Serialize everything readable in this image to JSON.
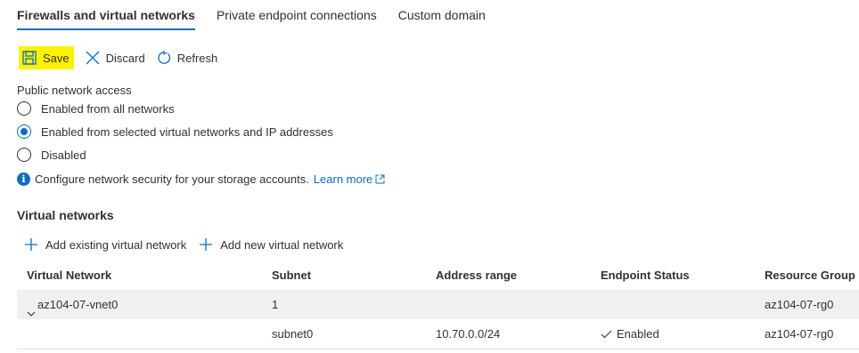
{
  "tabs": [
    {
      "label": "Firewalls and virtual networks",
      "active": true
    },
    {
      "label": "Private endpoint connections",
      "active": false
    },
    {
      "label": "Custom domain",
      "active": false
    }
  ],
  "toolbar": {
    "save_label": "Save",
    "discard_label": "Discard",
    "refresh_label": "Refresh",
    "save_highlight_color": "#fff200"
  },
  "public_access": {
    "label": "Public network access",
    "options": [
      {
        "label": "Enabled from all networks",
        "selected": false
      },
      {
        "label": "Enabled from selected virtual networks and IP addresses",
        "selected": true
      },
      {
        "label": "Disabled",
        "selected": false
      }
    ]
  },
  "info": {
    "text": "Configure network security for your storage accounts.",
    "link_label": "Learn more"
  },
  "virtual_networks": {
    "title": "Virtual networks",
    "add_existing_label": "Add existing virtual network",
    "add_new_label": "Add new virtual network",
    "columns": [
      "Virtual Network",
      "Subnet",
      "Address range",
      "Endpoint Status",
      "Resource Group"
    ],
    "group": {
      "name": "az104-07-vnet0",
      "subnet_count": "1",
      "resource_group": "az104-07-rg0"
    },
    "rows": [
      {
        "subnet": "subnet0",
        "address_range": "10.70.0.0/24",
        "status": "Enabled",
        "resource_group": "az104-07-rg0"
      }
    ]
  },
  "colors": {
    "accent": "#0f6cbd",
    "group_row_bg": "#f0f0f0"
  }
}
